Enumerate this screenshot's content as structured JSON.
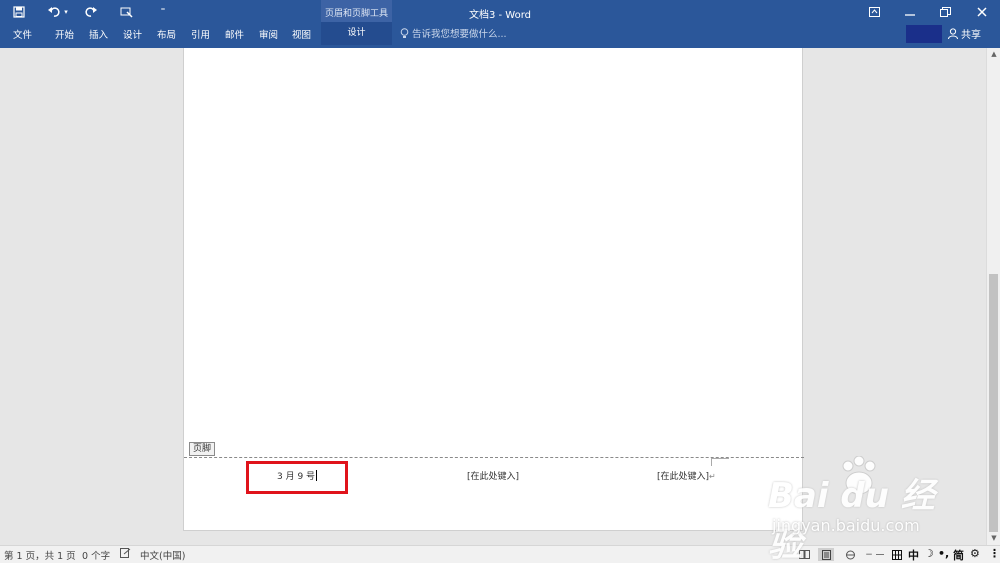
{
  "titlebar": {
    "qat": {
      "save_icon": "save-icon",
      "undo_icon": "undo-icon",
      "redo_icon": "redo-icon",
      "touch_icon": "touch-mode-icon",
      "customize_icon": "customize-qat-icon"
    },
    "context_group": "页眉和页脚工具",
    "context_tab": "设计",
    "doc_title": "文档3 - Word",
    "ribbon_display_icon": "ribbon-display-options-icon",
    "minimize_icon": "minimize-icon",
    "restore_icon": "restore-icon",
    "close_icon": "close-icon"
  },
  "ribbon": {
    "tabs": [
      "文件",
      "开始",
      "插入",
      "设计",
      "布局",
      "引用",
      "邮件",
      "审阅",
      "视图"
    ],
    "tell_me": "告诉我您想要做什么...",
    "share": "共享"
  },
  "document": {
    "footer_tag": "页脚",
    "footer_left": "3 月 9 号",
    "footer_center": "[在此处键入]",
    "footer_right": "[在此处键入]"
  },
  "statusbar": {
    "page": "第 1 页，共 1 页",
    "words": "0 个字",
    "language": "中文(中国)",
    "ime": [
      "中",
      "简"
    ]
  },
  "watermark": {
    "logo": "Bai du 经验",
    "url": "jingyan.baidu.com"
  },
  "colors": {
    "ribbon": "#2b579a",
    "context_group": "#3d63a5",
    "highlight": "#e0131b"
  }
}
